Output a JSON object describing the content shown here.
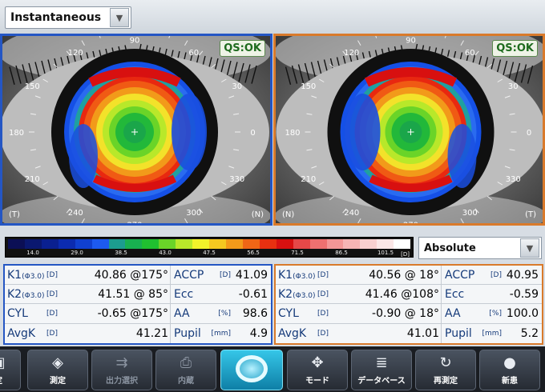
{
  "map_mode": {
    "value": "Instantaneous"
  },
  "eyes": {
    "right": {
      "status": "QS:OK",
      "angles": [
        "90",
        "60",
        "30",
        "0",
        "330",
        "300",
        "270",
        "240",
        "210",
        "180",
        "150",
        "120"
      ],
      "corners": {
        "bottom_left": "(T)",
        "bottom_right": "(N)"
      }
    },
    "left": {
      "status": "QS:OK",
      "angles": [
        "90",
        "60",
        "30",
        "0",
        "330",
        "300",
        "270",
        "240",
        "210",
        "180",
        "150",
        "120"
      ],
      "corners": {
        "bottom_left": "(N)",
        "bottom_right": "(T)"
      }
    }
  },
  "scale": {
    "colors": [
      "#0b0f55",
      "#0a1870",
      "#0a2090",
      "#0b2bb0",
      "#1040d0",
      "#1d5af0",
      "#1c9c8f",
      "#18b050",
      "#20c030",
      "#6ad428",
      "#b8e82a",
      "#f2f22a",
      "#f5c820",
      "#f39a1a",
      "#ef6616",
      "#e83010",
      "#d81010",
      "#e64848",
      "#ee7070",
      "#f39696",
      "#f6b4b4",
      "#f8cfcf",
      "#fbe6e6",
      "#ffffff"
    ],
    "ticks": [
      "14.0",
      "29.0",
      "38.5",
      "43.0",
      "47.5",
      "56.5",
      "71.5",
      "86.5",
      "101.5"
    ],
    "unit": "[D]"
  },
  "display_mode": {
    "value": "Absolute"
  },
  "measurements": {
    "right": [
      {
        "label": "K1",
        "sub": "(Φ3.0)",
        "unit": "[D]",
        "value": "40.86 @175°",
        "label2": "ACCP",
        "unit2": "[D]",
        "value2": "41.09"
      },
      {
        "label": "K2",
        "sub": "(Φ3.0)",
        "unit": "[D]",
        "value": "41.51 @  85°",
        "label2": "Ecc",
        "unit2": "",
        "value2": "-0.61"
      },
      {
        "label": "CYL",
        "sub": "",
        "unit": "[D]",
        "value": "-0.65 @175°",
        "label2": "AA",
        "unit2": "[%]",
        "value2": "98.6"
      },
      {
        "label": "AvgK",
        "sub": "",
        "unit": "[D]",
        "value": "41.21",
        "label2": "Pupil",
        "unit2": "[mm]",
        "value2": "4.9"
      }
    ],
    "left": [
      {
        "label": "K1",
        "sub": "(Φ3.0)",
        "unit": "[D]",
        "value": "40.56 @  18°",
        "label2": "ACCP",
        "unit2": "[D]",
        "value2": "40.95"
      },
      {
        "label": "K2",
        "sub": "(Φ3.0)",
        "unit": "[D]",
        "value": "41.46 @108°",
        "label2": "Ecc",
        "unit2": "",
        "value2": "-0.59"
      },
      {
        "label": "CYL",
        "sub": "",
        "unit": "[D]",
        "value": "-0.90 @  18°",
        "label2": "AA",
        "unit2": "[%]",
        "value2": "100.0"
      },
      {
        "label": "AvgK",
        "sub": "",
        "unit": "[D]",
        "value": "41.01",
        "label2": "Pupil",
        "unit2": "[mm]",
        "value2": "5.2"
      }
    ]
  },
  "toolbar": {
    "buttons": [
      {
        "name": "toolbar-edge-button",
        "label": "定",
        "icon": "▣",
        "state": "normal"
      },
      {
        "name": "toolbar-measure-button",
        "label": "測定",
        "icon": "◈",
        "state": "normal"
      },
      {
        "name": "toolbar-output-select-button",
        "label": "出力選択",
        "icon": "⇉",
        "state": "disabled"
      },
      {
        "name": "toolbar-print-button",
        "label": "内蔵",
        "icon": "⎙",
        "state": "disabled"
      },
      {
        "name": "toolbar-eye-mode-button",
        "label": "",
        "icon": "",
        "state": "active"
      },
      {
        "name": "toolbar-mode-button",
        "label": "モード",
        "icon": "✥",
        "state": "normal"
      },
      {
        "name": "toolbar-database-button",
        "label": "データベース",
        "icon": "≣",
        "state": "normal"
      },
      {
        "name": "toolbar-remeasure-button",
        "label": "再測定",
        "icon": "↻",
        "state": "normal"
      },
      {
        "name": "toolbar-new-patient-button",
        "label": "新患",
        "icon": "●",
        "state": "normal"
      }
    ]
  }
}
